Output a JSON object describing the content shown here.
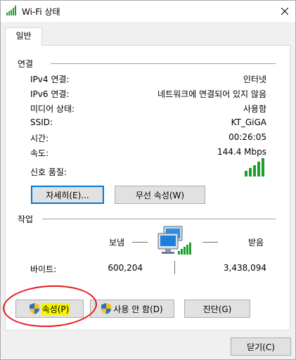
{
  "window": {
    "title": "Wi-Fi 상태",
    "icon": "wifi-signal-icon",
    "close_icon": "close-icon"
  },
  "tabs": [
    {
      "label": "일반",
      "active": true
    }
  ],
  "connection": {
    "section_title": "연결",
    "rows": [
      {
        "label": "IPv4 연결:",
        "value": "인터넷"
      },
      {
        "label": "IPv6 연결:",
        "value": "네트워크에 연결되어 있지 않음"
      },
      {
        "label": "미디어 상태:",
        "value": "사용함"
      },
      {
        "label": "SSID:",
        "value": "KT_GiGA"
      },
      {
        "label": "시간:",
        "value": "00:26:05"
      },
      {
        "label": "속도:",
        "value": "144.4 Mbps"
      }
    ],
    "signal_label": "신호 품질:",
    "signal_bars": 5,
    "details_button": "자세히(E)...",
    "wireless_props_button": "무선 속성(W)"
  },
  "activity": {
    "section_title": "작업",
    "sent_label": "보냄",
    "received_label": "받음",
    "bytes_label": "바이트:",
    "bytes_sent": "600,204",
    "bytes_received": "3,438,094"
  },
  "actions": {
    "properties_button": "속성(P)",
    "disable_button": "사용 안 함(D)",
    "diagnose_button": "진단(G)"
  },
  "footer": {
    "close_button": "닫기(C)"
  },
  "colors": {
    "signal_green": "#1e9e2c",
    "focus_blue": "#0078d7",
    "highlight_yellow": "#f5f500",
    "annotation_red": "#e8141c"
  }
}
